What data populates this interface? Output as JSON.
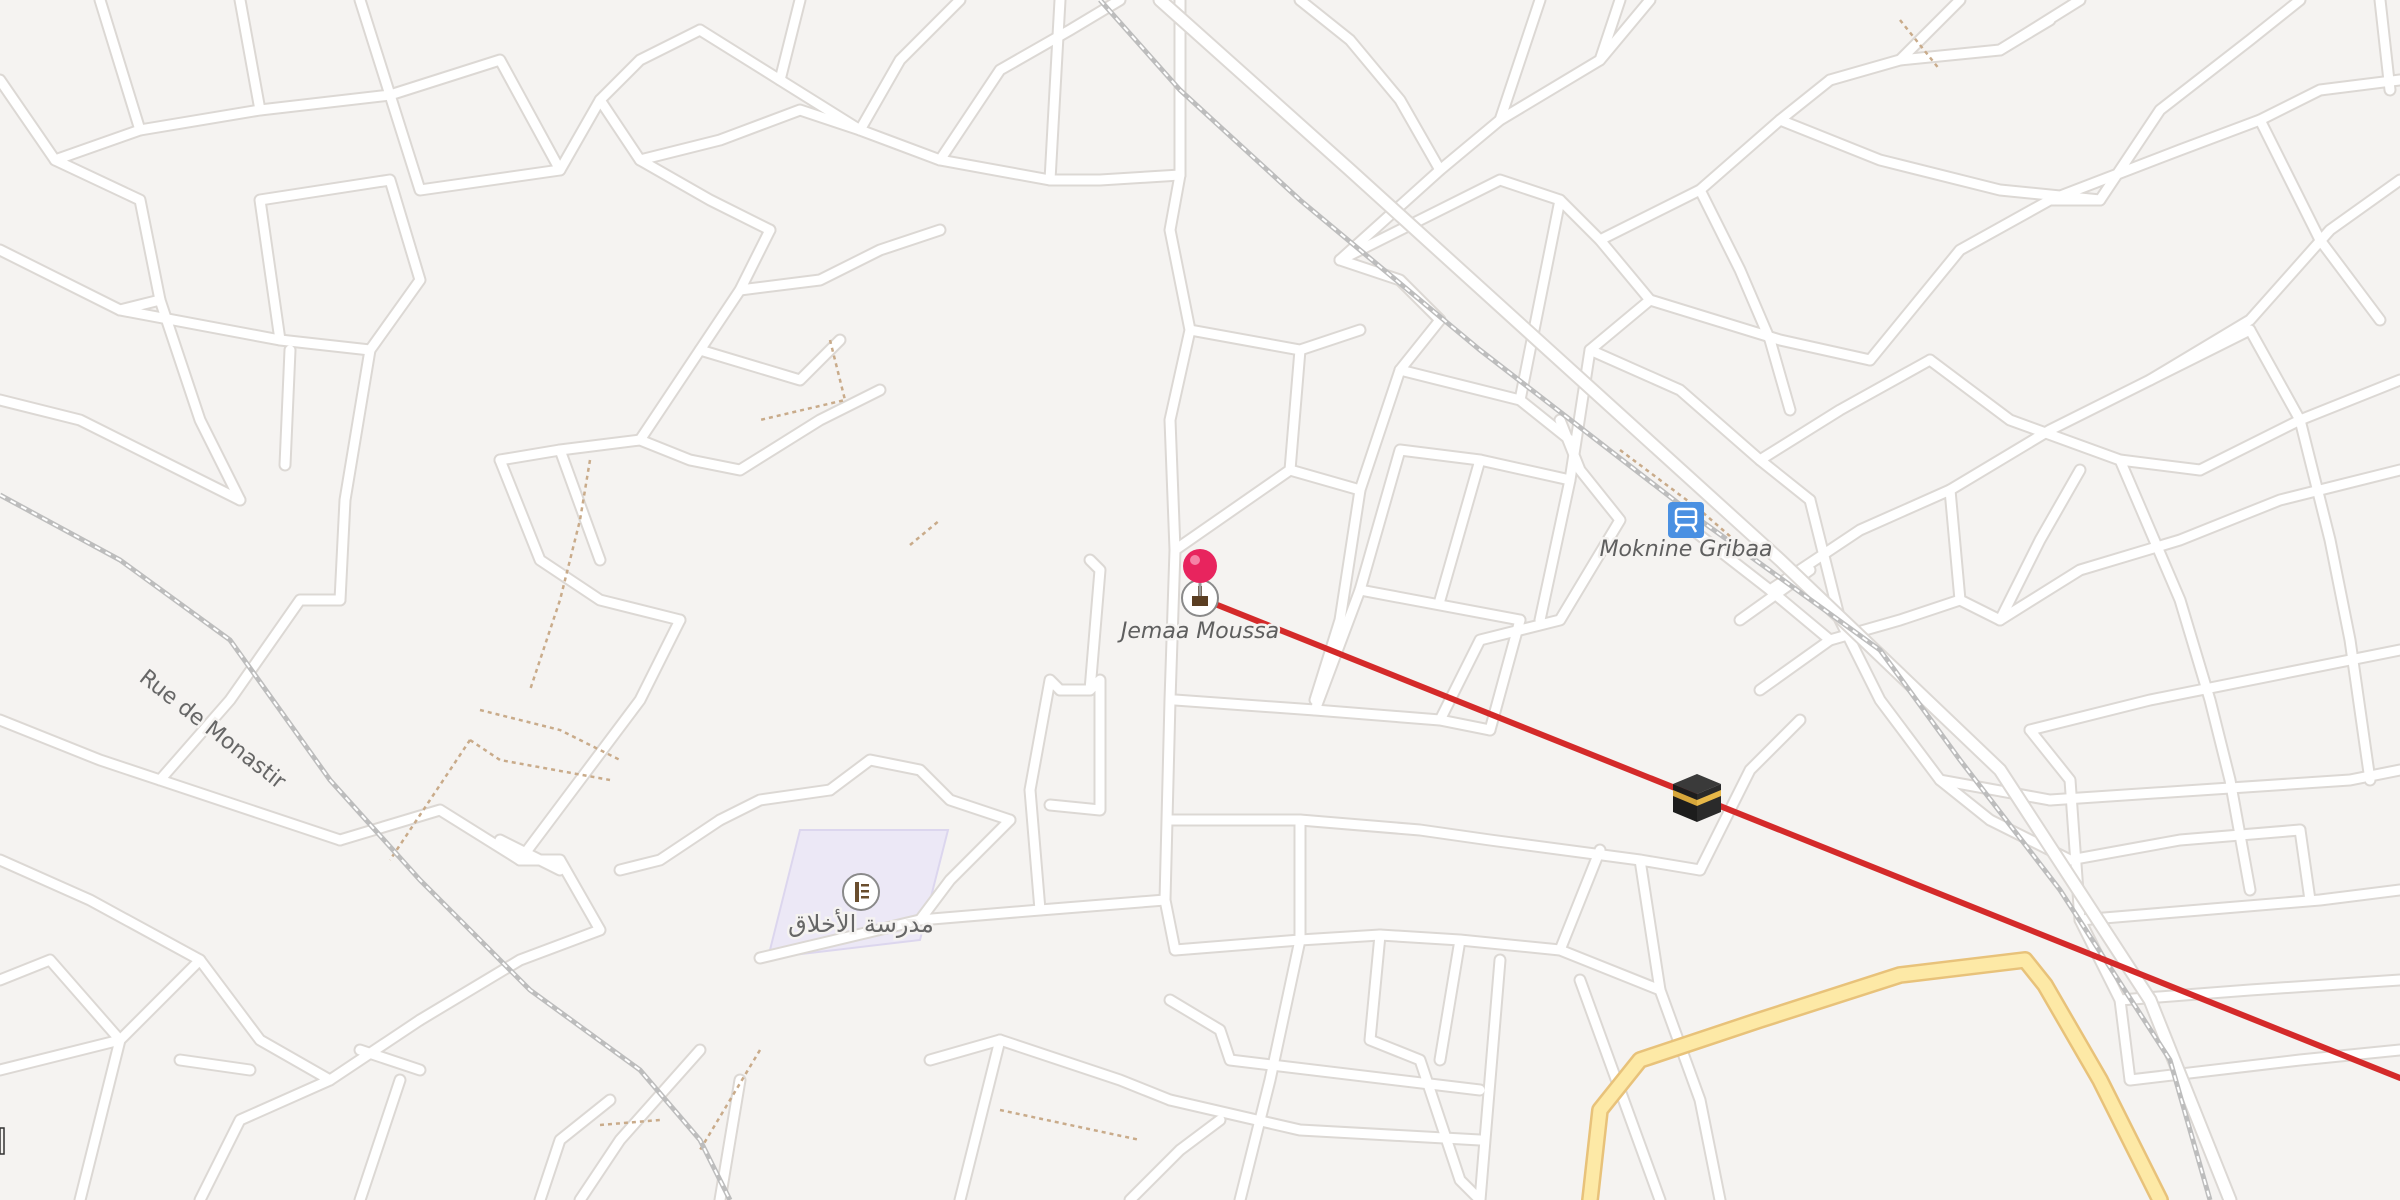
{
  "map": {
    "places": {
      "mosque": "Jemaa Moussa",
      "station": "Moknine Gribaa",
      "school": "مدرسة الأخلاق",
      "street": "Rue de Monastir"
    },
    "icons": {
      "pin": "map-pin-icon",
      "mosque": "mosque-icon",
      "station": "train-station-icon",
      "kaaba": "kaaba-icon",
      "school": "school-icon"
    },
    "colors": {
      "background": "#f5f3f1",
      "road_casing": "#dcd8d4",
      "road": "#ffffff",
      "main_road_fill": "#fde9a6",
      "main_road_casing": "#e8c27a",
      "route_line": "#d42a2a",
      "pin": "#e8245e",
      "school_area": "#ece8f6",
      "station_icon": "#4a90e2",
      "path": "#c9ab8a",
      "railway": "#bdbdbd"
    }
  }
}
